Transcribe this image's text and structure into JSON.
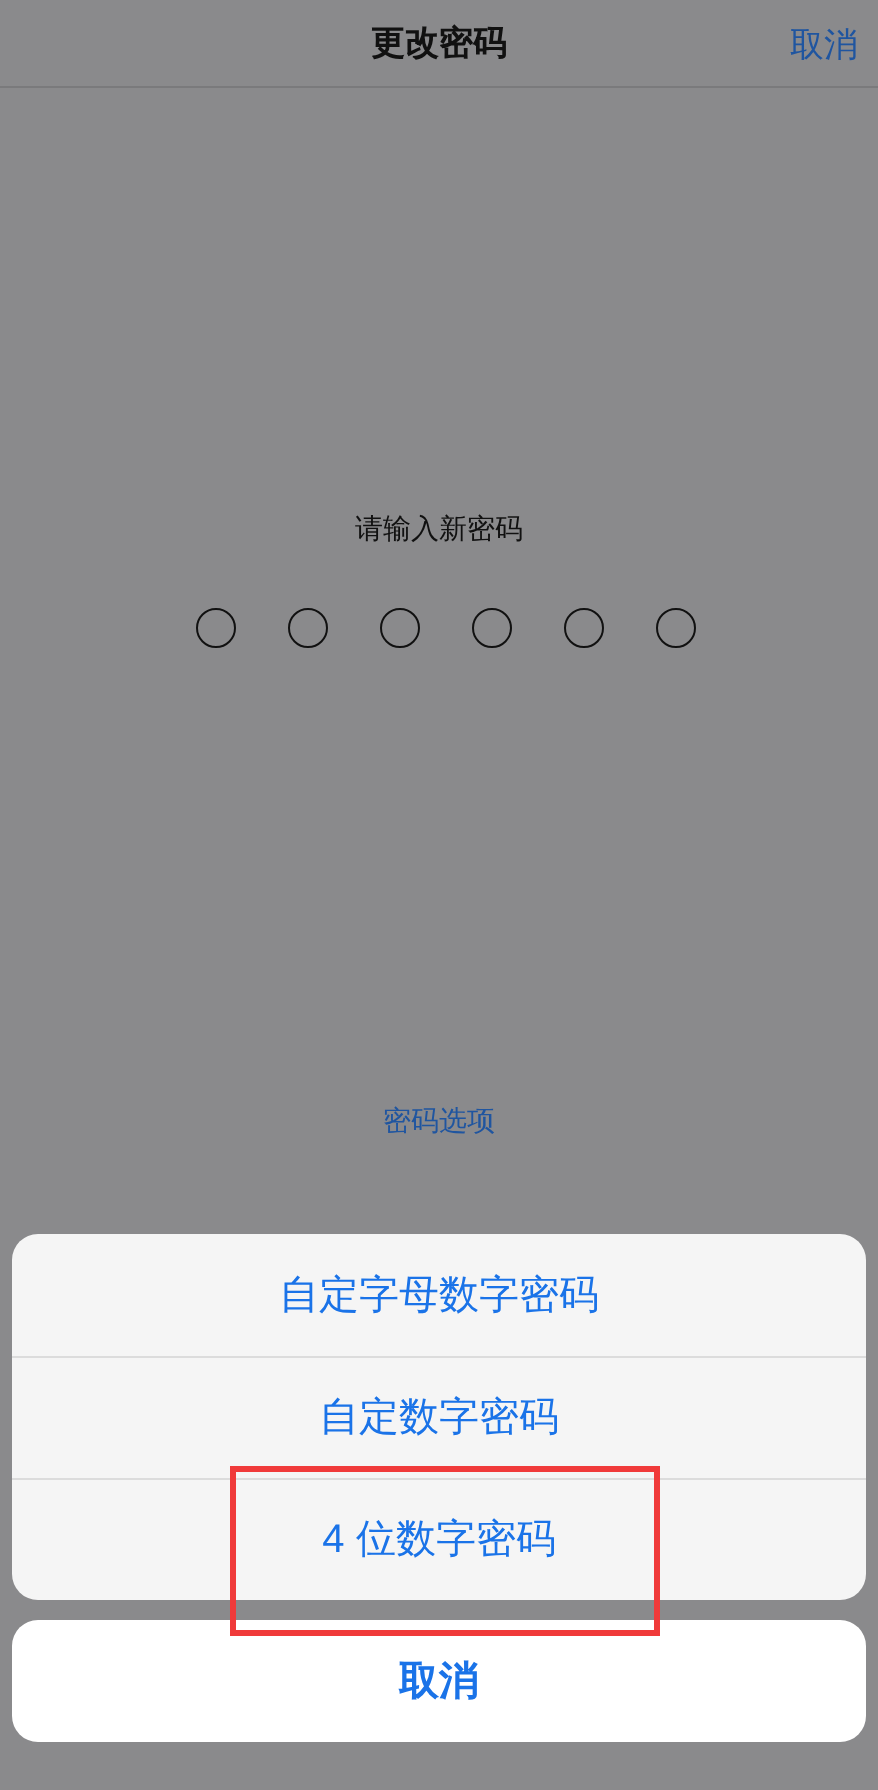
{
  "nav_bar": {
    "title": "更改密码",
    "cancel": "取消"
  },
  "prompt": "请输入新密码",
  "passcode_dots": [
    {
      "filled": false
    },
    {
      "filled": false
    },
    {
      "filled": false
    },
    {
      "filled": false
    },
    {
      "filled": false
    },
    {
      "filled": false
    }
  ],
  "options_link": "密码选项",
  "action_sheet": {
    "options": [
      {
        "label": "自定字母数字密码",
        "highlighted": false
      },
      {
        "label": "自定数字密码",
        "highlighted": false
      },
      {
        "label": "4 位数字密码",
        "highlighted": true
      }
    ],
    "cancel": "取消"
  }
}
